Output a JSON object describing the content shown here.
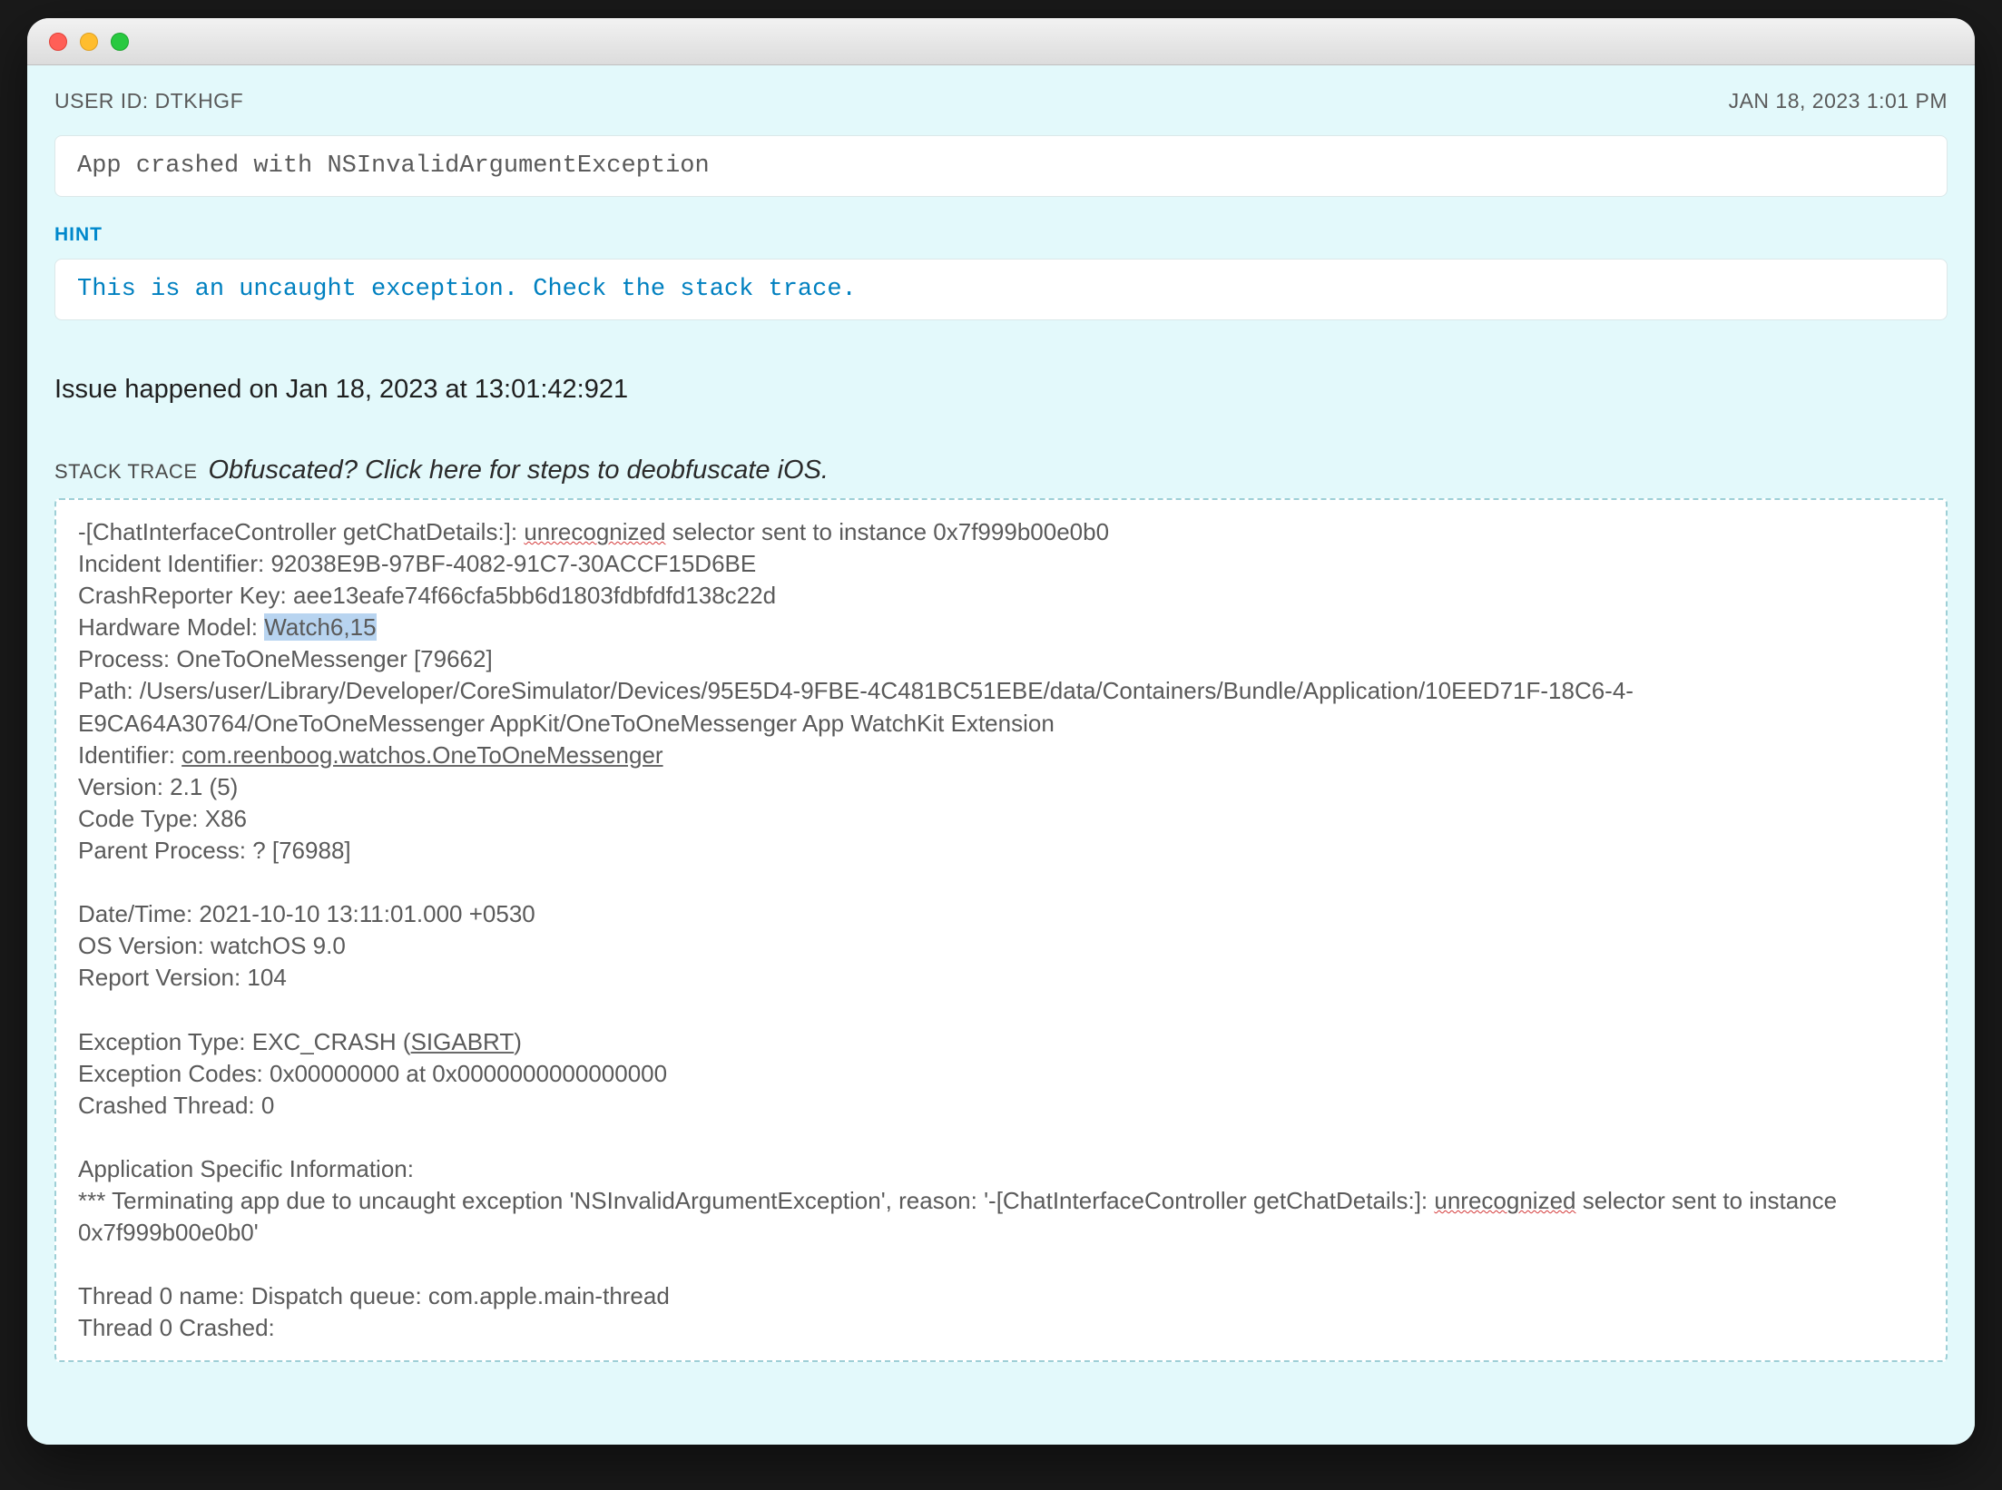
{
  "header": {
    "user_id_label": "USER ID: DTKHGF",
    "timestamp": "JAN 18, 2023 1:01 PM"
  },
  "crash_title": "App crashed with NSInvalidArgumentException",
  "hint": {
    "label": "HINT",
    "text": "This is an uncaught exception. Check the stack trace."
  },
  "issue_time": "Issue happened on Jan 18, 2023 at 13:01:42:921",
  "stack_section": {
    "label": "STACK TRACE",
    "deobfuscate_link": "Obfuscated? Click here for steps to deobfuscate iOS."
  },
  "stack_trace": {
    "line1_pre": "-[ChatInterfaceController getChatDetails:]: ",
    "line1_unrec": "unrecognized",
    "line1_post": " selector sent to instance 0x7f999b00e0b0",
    "incident": "Incident Identifier: 92038E9B-97BF-4082-91C7-30ACCF15D6BE",
    "crashkey": "CrashReporter Key: aee13eafe74f66cfa5bb6d1803fdbfdfd138c22d",
    "hwmodel_pre": "Hardware Model: ",
    "hwmodel_hl": "Watch6,15",
    "process": "Process: OneToOneMessenger [79662]",
    "path": "Path: /Users/user/Library/Developer/CoreSimulator/Devices/95E5D4-9FBE-4C481BC51EBE/data/Containers/Bundle/Application/10EED71F-18C6-4-E9CA64A30764/OneToOneMessenger AppKit/OneToOneMessenger App WatchKit Extension",
    "identifier_pre": "Identifier: ",
    "identifier_link": "com.reenboog.watchos.OneToOneMessenger",
    "version": "Version: 2.1 (5)",
    "codetype": "Code Type: X86",
    "parentproc": "Parent Process: ? [76988]",
    "datetime": "Date/Time: 2021-10-10 13:11:01.000 +0530",
    "osversion": "OS Version: watchOS 9.0",
    "reportversion": "Report Version: 104",
    "exctype_pre": "Exception Type: EXC_CRASH (",
    "exctype_link": "SIGABRT",
    "exctype_post": ")",
    "exccodes": "Exception Codes: 0x00000000 at 0x0000000000000000",
    "crashedthread": "Crashed Thread: 0",
    "appspecific_header": "Application Specific Information:",
    "appspecific_pre": "*** Terminating app due to uncaught exception 'NSInvalidArgumentException', reason: '-[ChatInterfaceController getChatDetails:]: ",
    "appspecific_unrec": "unrecognized",
    "appspecific_post": " selector sent to instance 0x7f999b00e0b0'",
    "thread0name": "Thread 0 name: Dispatch queue: com.apple.main-thread",
    "thread0crashed": "Thread 0 Crashed:"
  }
}
